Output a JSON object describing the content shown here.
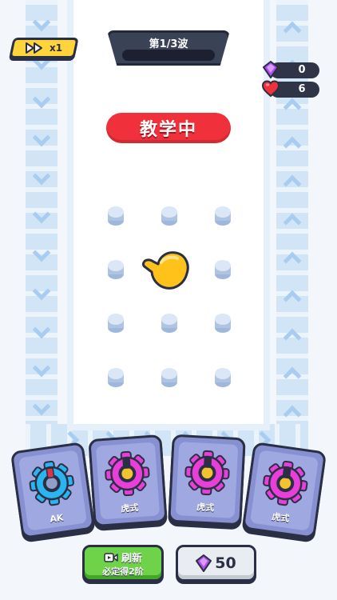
{
  "hud": {
    "speed_label": "x1",
    "wave_title": "第1/3波",
    "gems": "0",
    "hp": "6"
  },
  "banner": {
    "text": "教学中"
  },
  "cards": [
    {
      "name": "AK",
      "color": "#2ab4f0"
    },
    {
      "name": "虎式",
      "color": "#e83fd8"
    },
    {
      "name": "虎式",
      "color": "#e83fd8"
    },
    {
      "name": "虎式",
      "color": "#e83fd8"
    }
  ],
  "actions": {
    "refresh_line1": "刷新",
    "refresh_line2": "必定得2阶",
    "gem_cost": "50"
  },
  "colors": {
    "accent_red": "#f0303a",
    "accent_yellow": "#ffd43b",
    "accent_green": "#6fd34a"
  }
}
